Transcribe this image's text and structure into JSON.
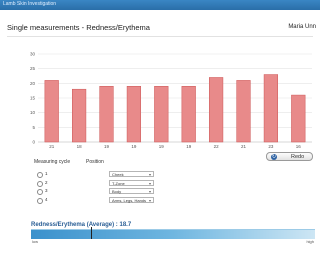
{
  "window": {
    "title": "Lamb Skin Investigation"
  },
  "page": {
    "title": "Single measurements - Redness/Erythema",
    "user": "Maria Unn"
  },
  "chart_data": {
    "type": "bar",
    "categories": [
      "21",
      "18",
      "19",
      "19",
      "19",
      "19",
      "22",
      "21",
      "23",
      "16"
    ],
    "values": [
      21,
      18,
      19,
      19,
      19,
      19,
      22,
      21,
      23,
      16
    ],
    "ylim": [
      0,
      30
    ],
    "yticks": [
      0,
      5,
      10,
      15,
      20,
      25,
      30
    ],
    "grid": true,
    "bar_color": "#e88a8a"
  },
  "refresh_label": "Redo",
  "columns": {
    "cycle": "Measuring cycle",
    "position": "Position"
  },
  "cycles": [
    {
      "num": "1",
      "position": "Cheek"
    },
    {
      "num": "2",
      "position": "T-Zone"
    },
    {
      "num": "3",
      "position": "Body"
    },
    {
      "num": "4",
      "position": "Arms, Legs, Hands"
    }
  ],
  "average": {
    "label": "Redness/Erythema (Average) : 18.7",
    "value": 18.7,
    "low_label": "low",
    "high_label": "high"
  },
  "colors": {
    "accent": "#2a6ea8",
    "bar": "#e88a8a"
  }
}
